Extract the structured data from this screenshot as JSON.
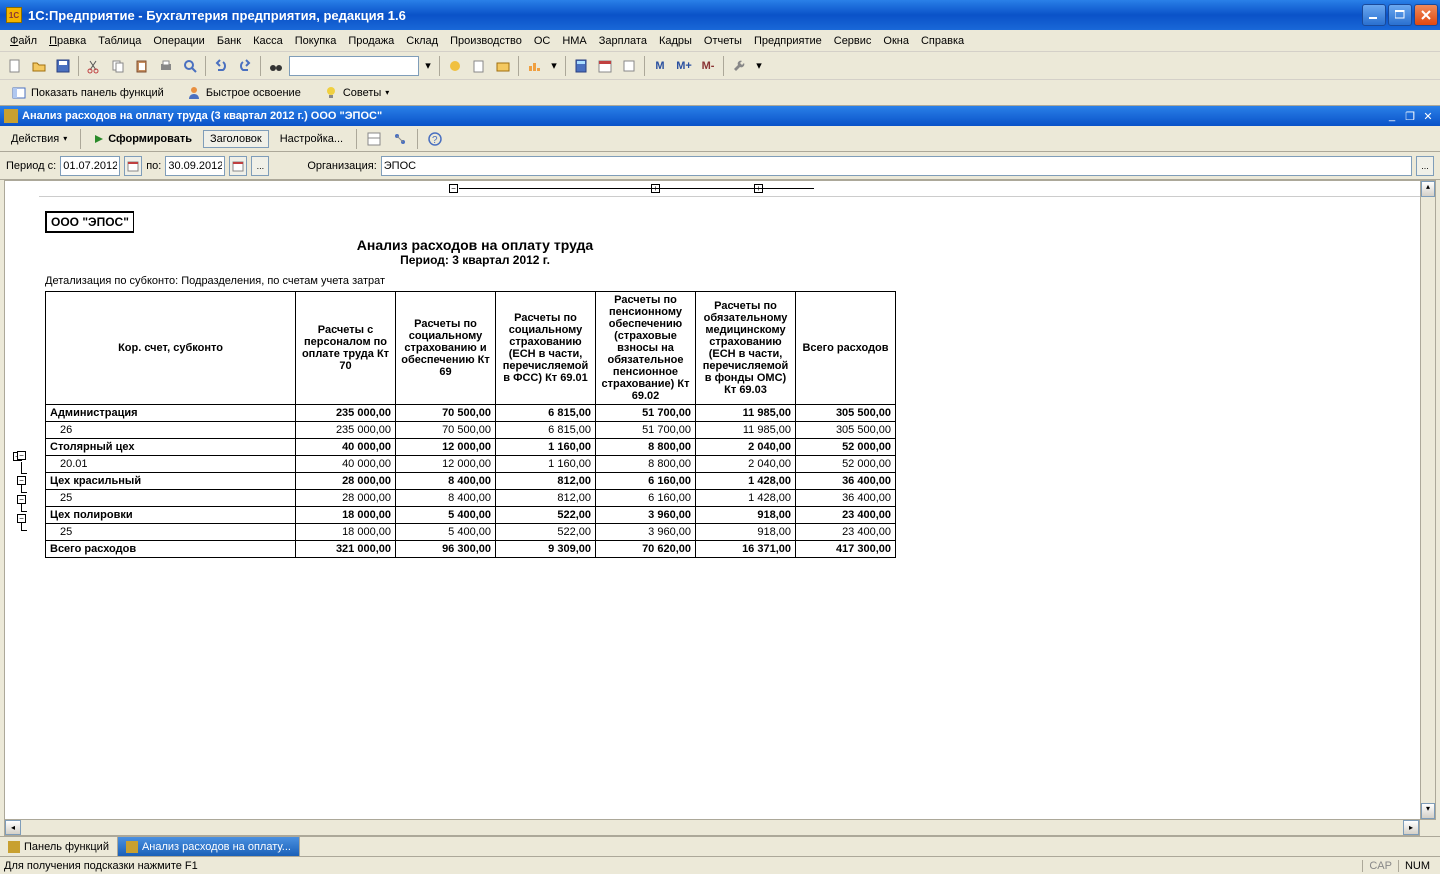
{
  "app": {
    "title": "1С:Предприятие  - Бухгалтерия предприятия, редакция 1.6"
  },
  "menu": [
    "Файл",
    "Правка",
    "Таблица",
    "Операции",
    "Банк",
    "Касса",
    "Покупка",
    "Продажа",
    "Склад",
    "Производство",
    "ОС",
    "НМА",
    "Зарплата",
    "Кадры",
    "Отчеты",
    "Предприятие",
    "Сервис",
    "Окна",
    "Справка"
  ],
  "toolbar2": {
    "show_panel": "Показать панель функций",
    "quick": "Быстрое освоение",
    "tips": "Советы"
  },
  "doc": {
    "title": "Анализ расходов на оплату труда (3 квартал 2012 г.) ООО \"ЭПОС\""
  },
  "doctool": {
    "actions": "Действия",
    "form": "Сформировать",
    "header": "Заголовок",
    "settings": "Настройка..."
  },
  "params": {
    "period_from_label": "Период с:",
    "period_from": "01.07.2012",
    "to_label": "по:",
    "period_to": "30.09.2012",
    "org_label": "Организация:",
    "org": "ЭПОС"
  },
  "report": {
    "org_name": "ООО \"ЭПОС\"",
    "title": "Анализ расходов на оплату труда",
    "period_line": "Период: 3 квартал 2012 г.",
    "subtitle": "Детализация по субконто: Подразделения, по счетам учета затрат",
    "columns": [
      "Кор. счет, субконто",
      "Расчеты с персоналом по оплате труда Кт 70",
      "Расчеты по социальному страхованию и обеспечению Кт 69",
      "Расчеты по социальному страхованию (ЕСН в части, перечисляемой в ФСС) Кт 69.01",
      "Расчеты по пенсионному обеспечению (страховые взносы на обязательное пенсионное страхование) Кт 69.02",
      "Расчеты по обязательному медицинскому страхованию (ЕСН в части, перечисляемой в фонды ОМС) Кт 69.03",
      "Всего расходов"
    ],
    "rows": [
      {
        "bold": true,
        "label": "Администрация",
        "v": [
          "235 000,00",
          "70 500,00",
          "6 815,00",
          "51 700,00",
          "11 985,00",
          "305 500,00"
        ]
      },
      {
        "indent": true,
        "label": "26",
        "v": [
          "235 000,00",
          "70 500,00",
          "6 815,00",
          "51 700,00",
          "11 985,00",
          "305 500,00"
        ]
      },
      {
        "bold": true,
        "label": "Столярный цех",
        "v": [
          "40 000,00",
          "12 000,00",
          "1 160,00",
          "8 800,00",
          "2 040,00",
          "52 000,00"
        ]
      },
      {
        "indent": true,
        "label": "20.01",
        "v": [
          "40 000,00",
          "12 000,00",
          "1 160,00",
          "8 800,00",
          "2 040,00",
          "52 000,00"
        ]
      },
      {
        "bold": true,
        "label": "Цех красильный",
        "v": [
          "28 000,00",
          "8 400,00",
          "812,00",
          "6 160,00",
          "1 428,00",
          "36 400,00"
        ]
      },
      {
        "indent": true,
        "label": "25",
        "v": [
          "28 000,00",
          "8 400,00",
          "812,00",
          "6 160,00",
          "1 428,00",
          "36 400,00"
        ]
      },
      {
        "bold": true,
        "label": "Цех полировки",
        "v": [
          "18 000,00",
          "5 400,00",
          "522,00",
          "3 960,00",
          "918,00",
          "23 400,00"
        ]
      },
      {
        "indent": true,
        "label": "25",
        "v": [
          "18 000,00",
          "5 400,00",
          "522,00",
          "3 960,00",
          "918,00",
          "23 400,00"
        ]
      },
      {
        "bold": true,
        "label": "Всего расходов",
        "v": [
          "321 000,00",
          "96 300,00",
          "9 309,00",
          "70 620,00",
          "16 371,00",
          "417 300,00"
        ]
      }
    ]
  },
  "tabs": {
    "panel": "Панель функций",
    "report": "Анализ расходов на оплату..."
  },
  "status": {
    "hint": "Для получения подсказки нажмите F1",
    "cap": "CAP",
    "num": "NUM"
  },
  "toolbar_m": {
    "m": "M",
    "mp": "M+",
    "mm": "M-"
  }
}
